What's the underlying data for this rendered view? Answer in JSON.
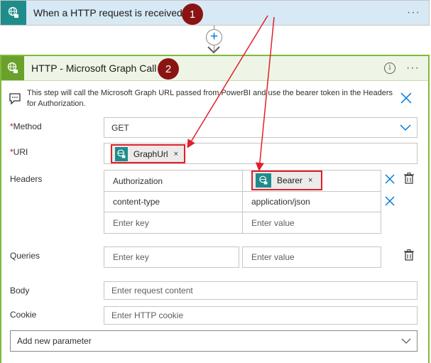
{
  "trigger": {
    "title": "When a HTTP request is received",
    "icon": "globe-icon",
    "step_badge": "1",
    "more": "···"
  },
  "connector": {
    "add_icon": "+"
  },
  "action": {
    "title": "HTTP - Microsoft Graph Call",
    "icon": "globe-icon",
    "step_badge": "2",
    "info": "i",
    "more": "···",
    "description": "This step will call the Microsoft Graph URL passed from PowerBI and use the bearer token in the Headers for Authorization.",
    "method": {
      "label": "Method",
      "required_mark": "*",
      "value": "GET"
    },
    "uri": {
      "label": "URI",
      "required_mark": "*",
      "token": "GraphUrl",
      "token_remove": "×"
    },
    "headers": {
      "label": "Headers",
      "rows": [
        {
          "key": "Authorization",
          "value_token": "Bearer",
          "token_remove": "×"
        },
        {
          "key": "content-type",
          "value": "application/json"
        },
        {
          "key_placeholder": "Enter key",
          "value_placeholder": "Enter value"
        }
      ]
    },
    "queries": {
      "label": "Queries",
      "key_placeholder": "Enter key",
      "value_placeholder": "Enter value"
    },
    "body": {
      "label": "Body",
      "placeholder": "Enter request content"
    },
    "cookie": {
      "label": "Cookie",
      "placeholder": "Enter HTTP cookie"
    },
    "add_parameter": "Add new parameter"
  },
  "colors": {
    "trigger_bg": "#d7e9f5",
    "trigger_icon": "#1f8c8c",
    "action_border": "#7fba3c",
    "action_header_bg": "#eef5e6",
    "badge": "#8a1414",
    "annotation": "#e0202a",
    "accent": "#0078d4"
  }
}
